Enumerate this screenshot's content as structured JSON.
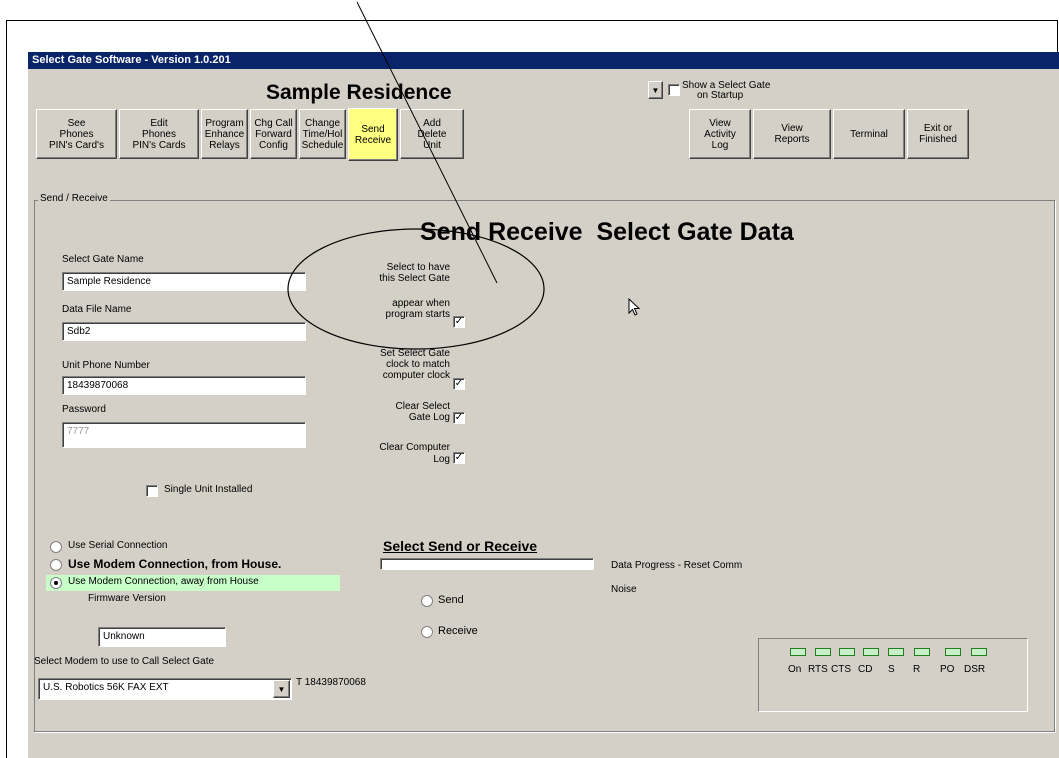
{
  "window": {
    "title": "Select Gate Software - Version 1.0.201",
    "residence_name": "Sample Residence",
    "startup_checkbox_label_line1": "Show a Select Gate",
    "startup_checkbox_label_line2": "on Startup"
  },
  "toolbar": {
    "buttons": [
      {
        "line1": "See",
        "line2": "Phones",
        "line3": "PIN's Card's"
      },
      {
        "line1": "Edit",
        "line2": "Phones",
        "line3": "PIN's Cards"
      },
      {
        "line1": "Program",
        "line2": "Enhance",
        "line3": "Relays"
      },
      {
        "line1": "Chg Call",
        "line2": "Forward",
        "line3": "Config"
      },
      {
        "line1": "Change",
        "line2": "Time/Hol",
        "line3": "Schedule"
      },
      {
        "line1": "Send",
        "line2": "Receive",
        "line3": ""
      },
      {
        "line1": "Add",
        "line2": "Delete",
        "line3": "Unit"
      },
      {
        "line1": "View",
        "line2": "Activity",
        "line3": "Log"
      },
      {
        "line1": "View",
        "line2": "Reports",
        "line3": ""
      },
      {
        "line1": "Terminal",
        "line2": "",
        "line3": ""
      },
      {
        "line1": "Exit or",
        "line2": "Finished",
        "line3": ""
      }
    ]
  },
  "group": {
    "title": "Send / Receive",
    "heading": "Send Receive  Select Gate Data"
  },
  "fields": {
    "gate_name_label": "Select Gate Name",
    "gate_name_value": "Sample Residence",
    "data_file_label": "Data File Name",
    "data_file_value": "Sdb2",
    "phone_label": "Unit Phone Number",
    "phone_value": "18439870068",
    "password_label": "Password",
    "password_value": "7777",
    "single_unit_label": "Single Unit Installed"
  },
  "options": {
    "opt1_line1": "Select to have",
    "opt1_line2": "this Select Gate",
    "opt1_line3": "appear when",
    "opt1_line4": "program starts",
    "opt2_line1": "Set Select Gate",
    "opt2_line2": "clock to match",
    "opt2_line3": "computer clock",
    "opt3_line1": "Clear Select",
    "opt3_line2": "Gate Log",
    "opt4_line1": "Clear Computer",
    "opt4_line2": "Log"
  },
  "connection": {
    "serial": "Use Serial Connection",
    "modem_house": "Use Modem Connection, from House.",
    "modem_away": "Use Modem Connection, away from House",
    "firmware_label": "Firmware Version",
    "firmware_value": "Unknown",
    "modem_select_label": "Select Modem to use to Call Select Gate",
    "modem_value": "U.S. Robotics 56K FAX EXT",
    "dial_string": "T 18439870068"
  },
  "send_receive": {
    "title": "Select Send or Receive",
    "send": "Send",
    "receive": "Receive",
    "progress_label": "Data Progress - Reset Comm",
    "noise_label": "Noise"
  },
  "status": {
    "labels": [
      "On",
      "RTS",
      "CTS",
      "CD",
      "S",
      "R",
      "PO",
      "DSR"
    ]
  },
  "colors": {
    "title_bar": "#0a246a",
    "window_face": "#d4d0c8",
    "send_button": "#ffff80",
    "highlight_row": "#c8ffc8"
  }
}
